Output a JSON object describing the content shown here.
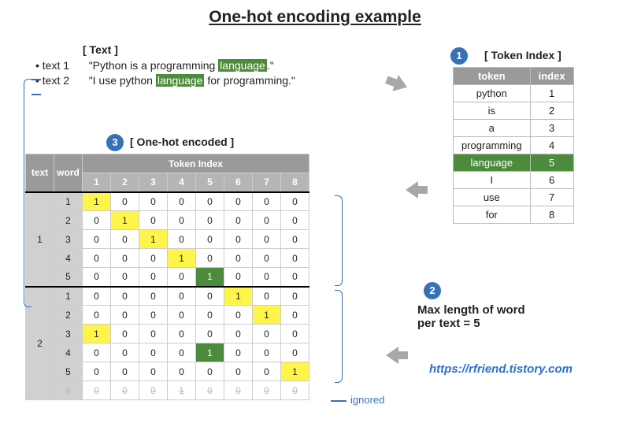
{
  "title": "One-hot encoding example",
  "text_section": {
    "header": "[ Text ]",
    "rows": [
      {
        "label": "text 1",
        "prefix": "\"Python is a programming ",
        "hl": "language",
        "suffix": ".\""
      },
      {
        "label": "text 2",
        "prefix": "\"I use python ",
        "hl": "language",
        "suffix": " for programming.\""
      }
    ]
  },
  "step_labels": {
    "one": "1",
    "two": "2",
    "three": "3"
  },
  "token_index": {
    "header": "[ Token Index ]",
    "cols": {
      "token": "token",
      "index": "index"
    },
    "rows": [
      {
        "token": "python",
        "index": "1"
      },
      {
        "token": "is",
        "index": "2"
      },
      {
        "token": "a",
        "index": "3"
      },
      {
        "token": "programming",
        "index": "4"
      },
      {
        "token": "language",
        "index": "5",
        "highlight": true
      },
      {
        "token": "I",
        "index": "6"
      },
      {
        "token": "use",
        "index": "7"
      },
      {
        "token": "for",
        "index": "8"
      }
    ]
  },
  "onehot": {
    "header": "[ One-hot encoded ]",
    "cols": {
      "text": "text",
      "word": "word",
      "ti": "Token Index"
    },
    "idx_cols": [
      "1",
      "2",
      "3",
      "4",
      "5",
      "6",
      "7",
      "8"
    ],
    "groups": [
      {
        "text": "1",
        "rows": [
          {
            "word": "1",
            "v": [
              "1",
              "0",
              "0",
              "0",
              "0",
              "0",
              "0",
              "0"
            ],
            "mark": {
              "0": "ylw"
            }
          },
          {
            "word": "2",
            "v": [
              "0",
              "1",
              "0",
              "0",
              "0",
              "0",
              "0",
              "0"
            ],
            "mark": {
              "1": "ylw"
            }
          },
          {
            "word": "3",
            "v": [
              "0",
              "0",
              "1",
              "0",
              "0",
              "0",
              "0",
              "0"
            ],
            "mark": {
              "2": "ylw"
            }
          },
          {
            "word": "4",
            "v": [
              "0",
              "0",
              "0",
              "1",
              "0",
              "0",
              "0",
              "0"
            ],
            "mark": {
              "3": "ylw"
            }
          },
          {
            "word": "5",
            "v": [
              "0",
              "0",
              "0",
              "0",
              "1",
              "0",
              "0",
              "0"
            ],
            "mark": {
              "4": "grn"
            }
          }
        ]
      },
      {
        "text": "2",
        "rows": [
          {
            "word": "1",
            "v": [
              "0",
              "0",
              "0",
              "0",
              "0",
              "1",
              "0",
              "0"
            ],
            "mark": {
              "5": "ylw"
            }
          },
          {
            "word": "2",
            "v": [
              "0",
              "0",
              "0",
              "0",
              "0",
              "0",
              "1",
              "0"
            ],
            "mark": {
              "6": "ylw"
            }
          },
          {
            "word": "3",
            "v": [
              "1",
              "0",
              "0",
              "0",
              "0",
              "0",
              "0",
              "0"
            ],
            "mark": {
              "0": "ylw"
            }
          },
          {
            "word": "4",
            "v": [
              "0",
              "0",
              "0",
              "0",
              "1",
              "0",
              "0",
              "0"
            ],
            "mark": {
              "4": "grn"
            }
          },
          {
            "word": "5",
            "v": [
              "0",
              "0",
              "0",
              "0",
              "0",
              "0",
              "0",
              "1"
            ],
            "mark": {
              "7": "ylw"
            }
          },
          {
            "word": "6",
            "v": [
              "0",
              "0",
              "0",
              "1",
              "0",
              "0",
              "0",
              "0"
            ],
            "ignored": true
          }
        ]
      }
    ]
  },
  "max_len_line1": "Max length of word",
  "max_len_line2": "per text = 5",
  "ignored_label": "ignored",
  "url": "https://rfriend.tistory.com"
}
